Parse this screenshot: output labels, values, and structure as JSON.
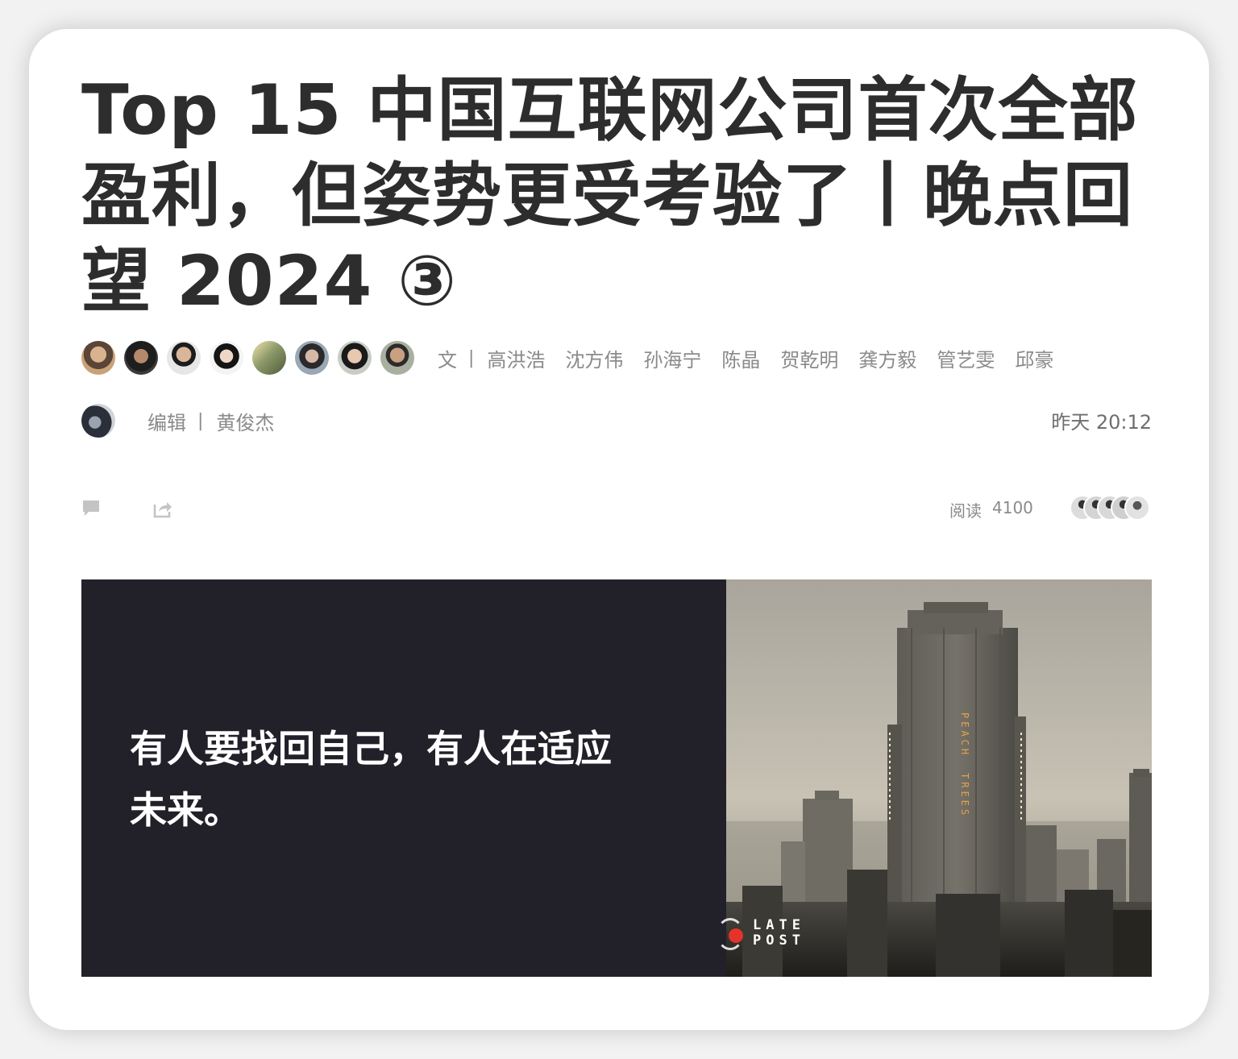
{
  "article": {
    "title": "Top 15 中国互联网公司首次全部盈利，但姿势更受考验了丨晚点回望 2024 ③",
    "authors_label": "文",
    "authors": [
      "高洪浩",
      "沈方伟",
      "孙海宁",
      "陈晶",
      "贺乾明",
      "龚方毅",
      "管艺雯",
      "邱豪"
    ],
    "editor_label": "编辑",
    "editor": "黄俊杰",
    "separator": "|",
    "timestamp": "昨天 20:12",
    "read_label": "阅读",
    "read_count": "4100"
  },
  "icons": {
    "comment": "comment-icon",
    "share": "share-icon"
  },
  "banner": {
    "text_line1": "有人要找回自己，有人在适应",
    "text_line2": "未来。",
    "tower_sign_1": "PEACH",
    "tower_sign_2": "TREES",
    "logo_line1": "LATE",
    "logo_line2": "POST",
    "colors": {
      "panel": "#22212a",
      "logo_dot": "#e5332a"
    }
  }
}
